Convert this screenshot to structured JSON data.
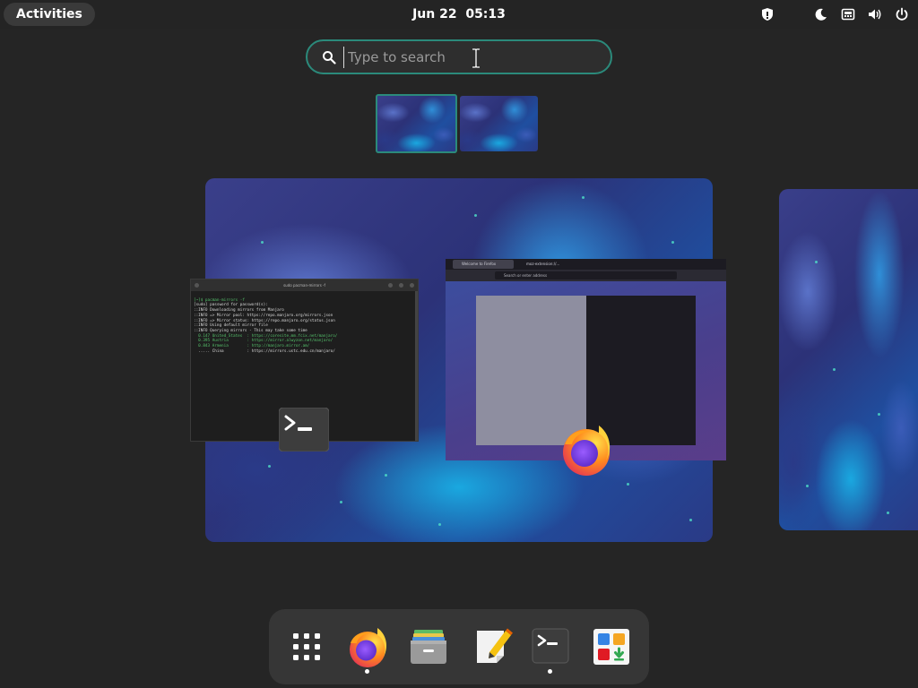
{
  "topbar": {
    "activities_label": "Activities",
    "date": "Jun 22",
    "time": "05:13",
    "tray_icons": [
      "shield-icon",
      "night-light-icon",
      "network-icon",
      "volume-icon",
      "power-icon"
    ]
  },
  "search": {
    "placeholder": "Type to search",
    "value": ""
  },
  "workspaces": {
    "active_index": 0,
    "count": 2
  },
  "windows": {
    "terminal": {
      "title": "sudo pacman-mirrors -f",
      "lines": [
        "[~]$ pacman-mirrors -f",
        "[sudo] password for password(s):",
        "::INFO Downloading mirrors from Manjaro",
        "::INFO => Mirror pool: https://repo.manjaro.org/mirrors.json",
        "::INFO => Mirror status: https://repo.manjaro.org/status.json",
        "::INFO Using default mirror file",
        "::INFO Querying mirrors - This may take some time",
        "  0.147 United_States  : https://coresite.mm.fcix.net/manjaro/",
        "  0.395 Austria        : https://mirror.alwyzon.net/manjaro/",
        "  0.843 Armenia        : http://manjaro.mirror.am/",
        "  ..... China          : https://mirrors.ustc.edu.cn/manjaro/"
      ],
      "app_icon": "terminal-icon"
    },
    "firefox": {
      "tab1": "Welcome to Firefox",
      "tab2": "moz-extension://...",
      "url_placeholder": "Search or enter address",
      "app_icon": "firefox-icon"
    }
  },
  "dock": {
    "items": [
      {
        "name": "show-apps",
        "icon": "grid-icon",
        "running": false
      },
      {
        "name": "firefox",
        "icon": "firefox-icon",
        "running": true
      },
      {
        "name": "files",
        "icon": "files-icon",
        "running": false
      },
      {
        "name": "text-editor",
        "icon": "text-editor-icon",
        "running": false
      },
      {
        "name": "terminal",
        "icon": "terminal-icon",
        "running": true
      },
      {
        "name": "software",
        "icon": "software-icon",
        "running": false
      }
    ]
  },
  "colors": {
    "accent": "#2b8a7b",
    "panel": "#242424",
    "background": "#252525",
    "dock": "#363636"
  }
}
